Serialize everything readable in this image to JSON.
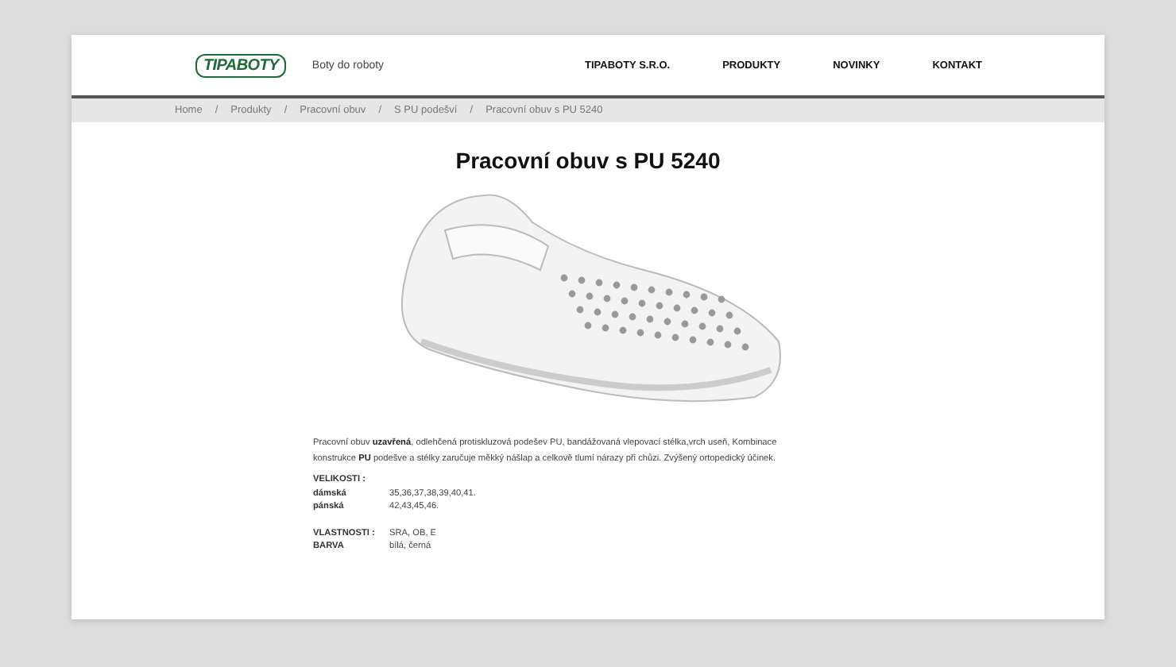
{
  "header": {
    "logo": "TIPABOTY",
    "tagline": "Boty do roboty",
    "nav": [
      {
        "label": "TIPABOTY S.R.O."
      },
      {
        "label": "PRODUKTY"
      },
      {
        "label": "NOVINKY"
      },
      {
        "label": "KONTAKT"
      }
    ]
  },
  "breadcrumb_separator": "/",
  "breadcrumb": [
    "Home",
    "Produkty",
    "Pracovní obuv",
    "S PU podešví",
    "Pracovní obuv s PU 5240"
  ],
  "product": {
    "title": "Pracovní obuv s PU 5240",
    "description": "Pracovní obuv **uzavřená**, odlehčená protiskluzová podešev PU, bandážovaná vlepovací stélka,vrch useň,  Kombinace konstrukce **PU** podešve a stélky zaručuje měkký nášlap a celkově tlumí nárazy při chůzi. Zvýšený ortopedický účinek.",
    "sizes_heading": "VELIKOSTI :",
    "sizes": [
      {
        "label": "dámská",
        "value": "35,36,37,38,39,40,41."
      },
      {
        "label": "pánská",
        "value": "42,43,45,46."
      }
    ],
    "properties": [
      {
        "label": "VLASTNOSTI :",
        "value": "SRA, OB, E"
      },
      {
        "label": "BARVA",
        "value": "bílá, černá"
      }
    ]
  }
}
